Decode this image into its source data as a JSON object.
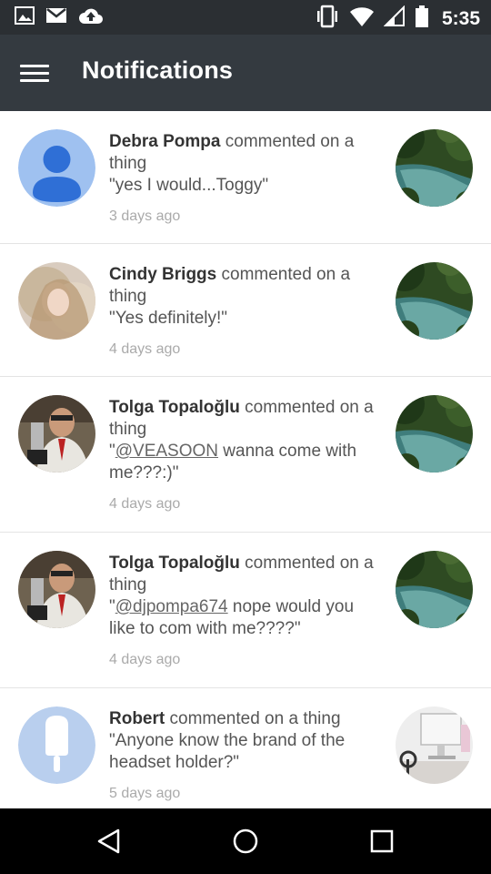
{
  "status_bar": {
    "time": "5:35",
    "left_icons": [
      "image-icon",
      "gmail-icon",
      "cloud-upload-icon"
    ],
    "right_icons": [
      "vibrate-icon",
      "wifi-icon",
      "cell-signal-icon",
      "battery-icon"
    ]
  },
  "app_bar": {
    "title": "Notifications",
    "menu_icon": "hamburger-menu-icon"
  },
  "notifications": [
    {
      "actor": "Debra Pompa",
      "action": " commented on a thing",
      "quote_open": "\"",
      "mention": "",
      "message": "yes I would...Toggy\"",
      "time": "3 days ago",
      "avatar": "default-person-avatar",
      "thumb": "jungle-pool-photo"
    },
    {
      "actor": "Cindy Briggs",
      "action": " commented on a thing",
      "quote_open": "\"",
      "mention": "",
      "message": "Yes definitely!\"",
      "time": "4 days ago",
      "avatar": "blonde-woman-photo",
      "thumb": "jungle-pool-photo"
    },
    {
      "actor": "Tolga Topaloğlu",
      "action": " commented on a thing",
      "quote_open": "\"",
      "mention": "@VEASOON",
      "message": " wanna come with me???:)\"",
      "time": "4 days ago",
      "avatar": "man-with-trophy-photo",
      "thumb": "jungle-pool-photo"
    },
    {
      "actor": "Tolga Topaloğlu",
      "action": " commented on a thing",
      "quote_open": "\"",
      "mention": "@djpompa674",
      "message": " nope would you like to com with me????\"",
      "time": "4 days ago",
      "avatar": "man-with-trophy-photo",
      "thumb": "jungle-pool-photo"
    },
    {
      "actor": "Robert",
      "action": " commented on a thing",
      "quote_open": "\"",
      "mention": "",
      "message": "Anyone know the brand of the headset holder?\"",
      "time": "5 days ago",
      "avatar": "popsicle-avatar",
      "thumb": "desk-computer-photo"
    }
  ],
  "nav_bar": {
    "back": "back-triangle-icon",
    "home": "home-circle-icon",
    "recents": "recents-square-icon"
  },
  "colors": {
    "status_bar": "#2b2f33",
    "app_bar": "#343a40",
    "default_avatar_bg": "#9fc1f0",
    "default_avatar_fg": "#2f6fd6"
  }
}
